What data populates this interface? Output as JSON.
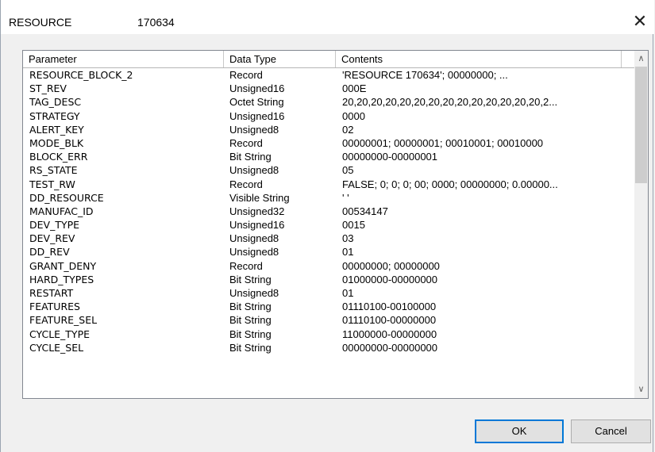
{
  "window": {
    "title": "RESOURCE",
    "title_id": "170634",
    "close_glyph": "✕"
  },
  "table": {
    "columns": [
      "Parameter",
      "Data Type",
      "Contents"
    ],
    "rows": [
      {
        "param": "RESOURCE_BLOCK_2",
        "type": "Record",
        "contents": "'RESOURCE              170634'; 00000000; ..."
      },
      {
        "param": "ST_REV",
        "type": "Unsigned16",
        "contents": "000E"
      },
      {
        "param": "TAG_DESC",
        "type": "Octet String",
        "contents": "20,20,20,20,20,20,20,20,20,20,20,20,20,20,2..."
      },
      {
        "param": "STRATEGY",
        "type": "Unsigned16",
        "contents": "0000"
      },
      {
        "param": "ALERT_KEY",
        "type": "Unsigned8",
        "contents": "02"
      },
      {
        "param": "MODE_BLK",
        "type": "Record",
        "contents": "00000001; 00000001; 00010001; 00010000"
      },
      {
        "param": "BLOCK_ERR",
        "type": "Bit String",
        "contents": "00000000-00000001"
      },
      {
        "param": "RS_STATE",
        "type": "Unsigned8",
        "contents": "05"
      },
      {
        "param": "TEST_RW",
        "type": "Record",
        "contents": "FALSE; 0; 0; 0; 00; 0000; 00000000; 0.00000..."
      },
      {
        "param": "DD_RESOURCE",
        "type": "Visible String",
        "contents": "'                               '"
      },
      {
        "param": "MANUFAC_ID",
        "type": "Unsigned32",
        "contents": "00534147"
      },
      {
        "param": "DEV_TYPE",
        "type": "Unsigned16",
        "contents": "0015"
      },
      {
        "param": "DEV_REV",
        "type": "Unsigned8",
        "contents": "03"
      },
      {
        "param": "DD_REV",
        "type": "Unsigned8",
        "contents": "01"
      },
      {
        "param": "GRANT_DENY",
        "type": "Record",
        "contents": "00000000; 00000000"
      },
      {
        "param": "HARD_TYPES",
        "type": "Bit String",
        "contents": "01000000-00000000"
      },
      {
        "param": "RESTART",
        "type": "Unsigned8",
        "contents": "01"
      },
      {
        "param": "FEATURES",
        "type": "Bit String",
        "contents": "01110100-00100000"
      },
      {
        "param": "FEATURE_SEL",
        "type": "Bit String",
        "contents": "01110100-00000000"
      },
      {
        "param": "CYCLE_TYPE",
        "type": "Bit String",
        "contents": "11000000-00000000"
      },
      {
        "param": "CYCLE_SEL",
        "type": "Bit String",
        "contents": "00000000-00000000"
      }
    ]
  },
  "scrollbar": {
    "up_glyph": "∧",
    "down_glyph": "∨"
  },
  "buttons": {
    "ok_label": "OK",
    "cancel_label": "Cancel"
  },
  "colors": {
    "focus_border": "#0078d7"
  }
}
